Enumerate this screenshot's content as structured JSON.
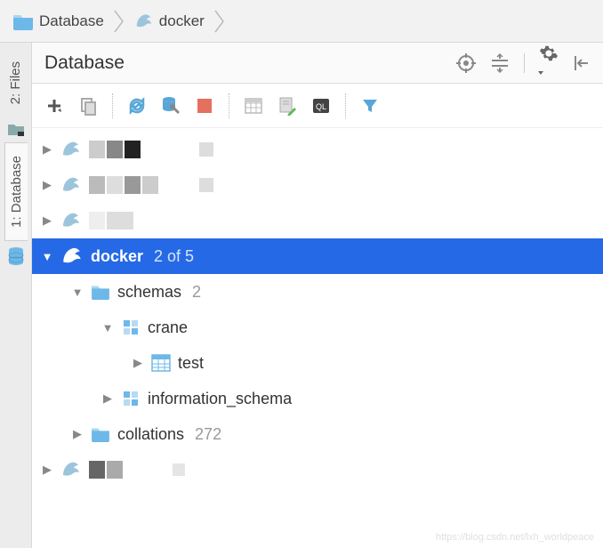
{
  "breadcrumb": {
    "root_label": "Database",
    "node_label": "docker"
  },
  "left_rail": {
    "tab_files": "2: Files",
    "tab_database": "1: Database"
  },
  "panel": {
    "title": "Database"
  },
  "tree": {
    "datasources": [
      {
        "label": "",
        "redacted": true
      },
      {
        "label": "",
        "redacted": true
      },
      {
        "label": "",
        "redacted": true
      }
    ],
    "selected": {
      "label": "docker",
      "meta": "2 of 5"
    },
    "schemas_label": "schemas",
    "schemas_count": "2",
    "schema_a": "crane",
    "table_a": "test",
    "schema_b": "information_schema",
    "collations_label": "collations",
    "collations_count": "272"
  },
  "watermark": "https://blog.csdn.net/lxh_worldpeace"
}
